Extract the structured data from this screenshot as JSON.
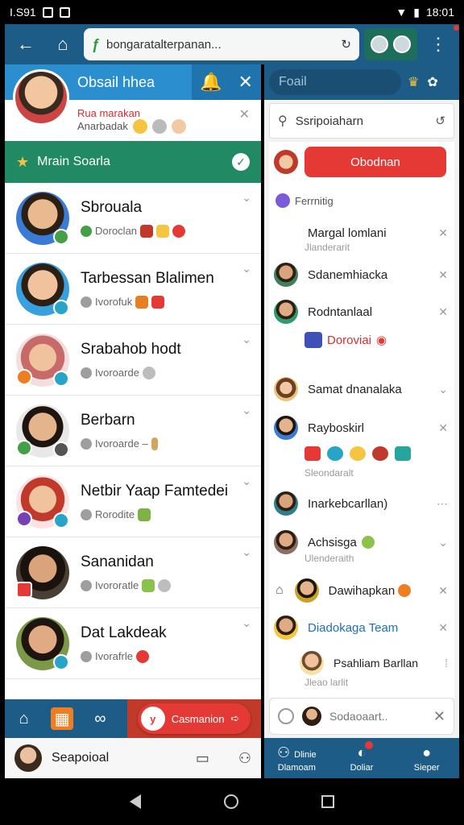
{
  "status_bar": {
    "left_text": "I.S91",
    "time": "18:01"
  },
  "browser": {
    "url": "bongaratalterpanan..."
  },
  "left_panel": {
    "header_title": "Obsail hhea",
    "sub_red": "Rua marakan",
    "sub_grey": "Anarbadak",
    "section_title": "Mrain Soarla",
    "contacts": [
      {
        "name": "Sbrouala",
        "status": "Doroclan"
      },
      {
        "name": "Tarbessan Blalimen",
        "status": "Ivorofuk"
      },
      {
        "name": "Srabahob hodt",
        "status": "Ivoroarde"
      },
      {
        "name": "Berbarn",
        "status": "Ivoroarde –"
      },
      {
        "name": "Netbir Yaap Famtedei",
        "status": "Rorodite"
      },
      {
        "name": "Sananidan",
        "status": "Ivororatle"
      },
      {
        "name": "Dat Lakdeak",
        "status": "Ivorafrle"
      }
    ],
    "cta_label": "Casmanion",
    "footer_label": "Seapoioal"
  },
  "right_panel": {
    "pill_text": "Foail",
    "search_text": "Ssripoiaharn",
    "red_pill": "Obodnan",
    "section_label": "Ferrnitig",
    "items": {
      "margat": "Margal lomlani",
      "margat_sub": "Jlanderarit",
      "sdan": "Sdanemhiacka",
      "rodn": "Rodntanlaal",
      "rodn_link": "Doroviai",
      "samat": "Samat dnanalaka",
      "ray": "Rayboskirl",
      "ray_sub": "Sleondaralt",
      "inarke": "Inarkebcarllan)",
      "ach": "Achsisga",
      "ach_sub": "Ulenderaith",
      "daw": "Dawihapkan",
      "diado": "Diadokaga Team",
      "psah": "Psahliam Barllan",
      "psah_sub": "Jleao larlit"
    },
    "bottom_input": "Sodaoaart..",
    "tabs": [
      {
        "line1": "Dlinie",
        "line2": "Dlamoam"
      },
      {
        "line1": "",
        "line2": "Doliar"
      },
      {
        "line1": "",
        "line2": "Sieper"
      }
    ]
  }
}
